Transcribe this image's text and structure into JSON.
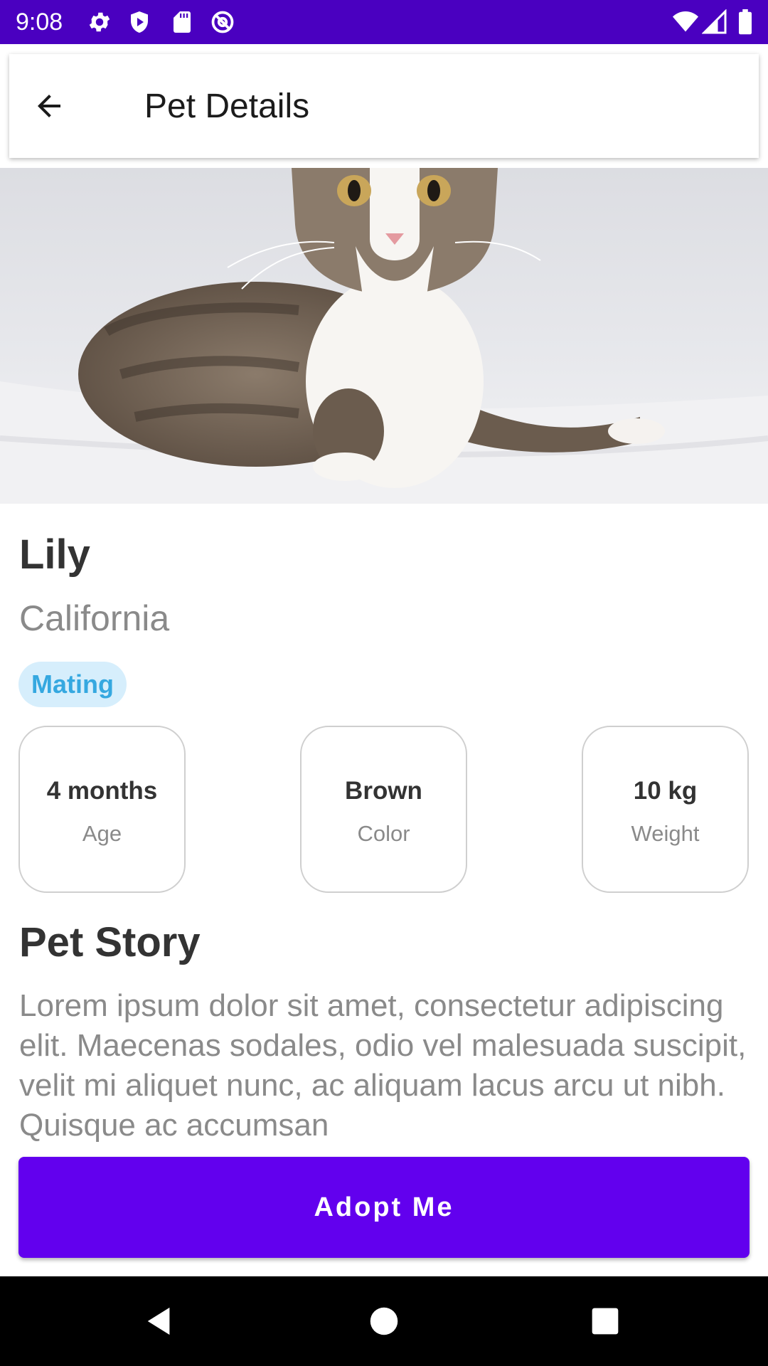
{
  "status_bar": {
    "time": "9:08",
    "left_icons": [
      "settings-icon",
      "play-protect-icon",
      "sd-card-icon",
      "at-sign-icon"
    ],
    "right_icons": [
      "wifi-icon",
      "signal-icon",
      "battery-icon"
    ],
    "background_color": "#4a00c0"
  },
  "app_bar": {
    "title": "Pet Details",
    "back_icon": "arrow-back-icon"
  },
  "hero": {
    "image": "tabby-white-cat-photo"
  },
  "pet": {
    "name": "Lily",
    "location": "California",
    "tag": "Mating"
  },
  "stats": [
    {
      "value": "4 months",
      "label": "Age"
    },
    {
      "value": "Brown",
      "label": "Color"
    },
    {
      "value": "10 kg",
      "label": "Weight"
    }
  ],
  "story": {
    "heading": "Pet Story",
    "text": "Lorem ipsum dolor sit amet, consectetur adipiscing elit. Maecenas sodales, odio vel malesuada suscipit, velit mi aliquet nunc, ac aliquam lacus arcu ut nibh. Quisque ac accumsan"
  },
  "actions": {
    "adopt_label": "Adopt Me"
  },
  "colors": {
    "accent": "#6200ee",
    "tag_background": "#d6eefc",
    "tag_text": "#35a8e0"
  },
  "nav_bar": {
    "icons": [
      "back-triangle-icon",
      "home-circle-icon",
      "recents-square-icon"
    ]
  }
}
